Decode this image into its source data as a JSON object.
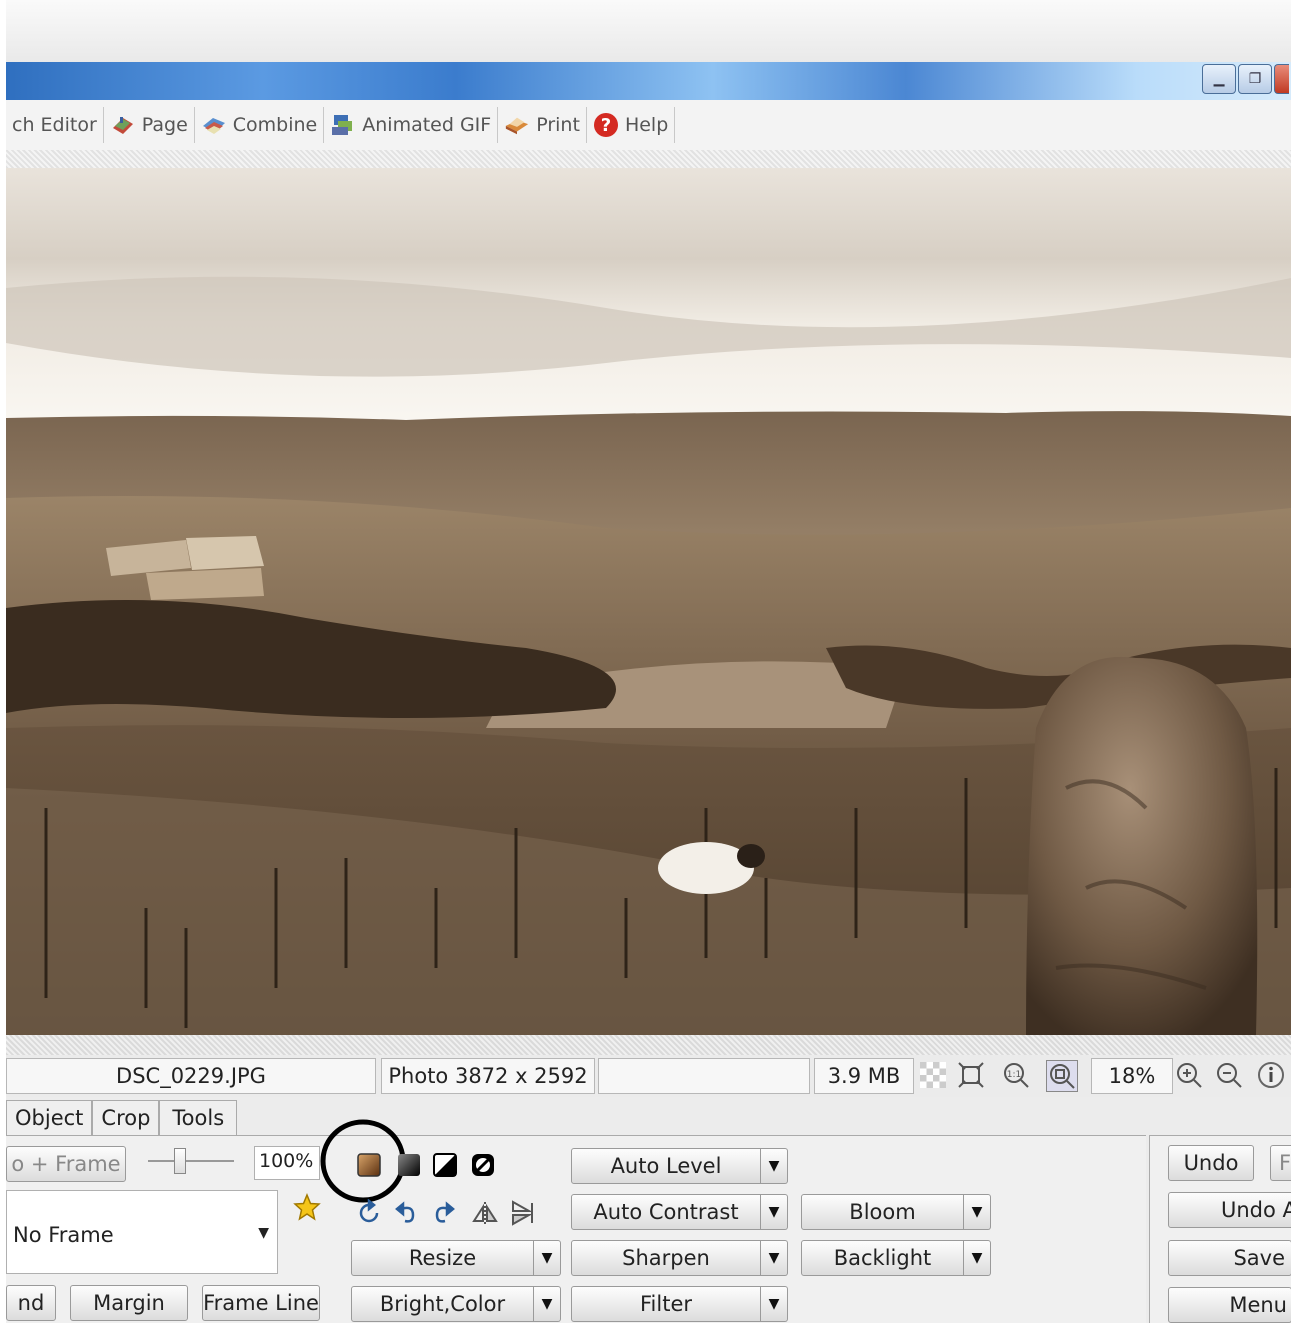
{
  "window": {
    "controls": [
      "minimize",
      "restore",
      "close"
    ]
  },
  "menu": {
    "items": [
      {
        "label": "ch Editor",
        "icon": "none"
      },
      {
        "label": "Page",
        "icon": "page-icon"
      },
      {
        "label": "Combine",
        "icon": "combine-icon"
      },
      {
        "label": "Animated GIF",
        "icon": "animated-gif-icon"
      },
      {
        "label": "Print",
        "icon": "print-icon"
      },
      {
        "label": "Help",
        "icon": "help-icon"
      }
    ]
  },
  "photo": {
    "description_free": true,
    "tone": "sepia"
  },
  "status": {
    "filename": "DSC_0229.JPG",
    "dimensions": "Photo 3872 x 2592",
    "extra": "",
    "filesize": "3.9 MB",
    "zoom": "18%"
  },
  "tabs": [
    "Object",
    "Crop",
    "Tools"
  ],
  "frame_panel": {
    "mode_label": "o + Frame",
    "opacity_value": "100%",
    "frame_select": "No Frame",
    "buttons": [
      "nd",
      "Margin",
      "Frame Line"
    ]
  },
  "effects": {
    "resize": "Resize",
    "bright_color": "Bright,Color",
    "auto_level": "Auto Level",
    "auto_contrast": "Auto Contrast",
    "sharpen": "Sharpen",
    "filter": "Filter",
    "bloom": "Bloom",
    "backlight": "Backlight"
  },
  "right_panel": {
    "undo": "Undo",
    "undo_all": "Undo A",
    "save": "Save",
    "menu": "Menu",
    "redo_partial": "F"
  },
  "colors": {
    "titlebar_accent": "#3b7ccd",
    "sepia_light": "#cbbba4",
    "sepia_dark": "#3a2c1f",
    "highlight_circle": "#000000"
  }
}
